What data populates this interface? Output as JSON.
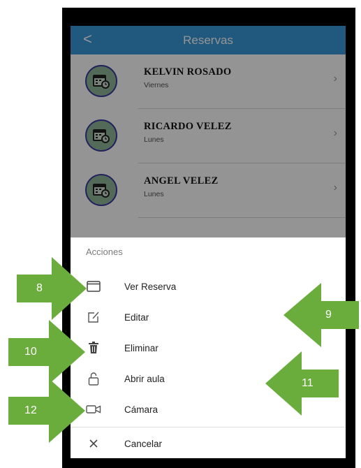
{
  "header": {
    "back_icon": "chevron-left-icon",
    "back_glyph": "<",
    "title": "Reservas"
  },
  "reservations": [
    {
      "name": "KELVIN ROSADO",
      "day": "Viernes"
    },
    {
      "name": "RICARDO VELEZ",
      "day": "Lunes"
    },
    {
      "name": "ANGEL VELEZ",
      "day": "Lunes"
    }
  ],
  "sheet": {
    "title": "Acciones",
    "actions": [
      {
        "label": "Ver Reserva",
        "icon": "window-icon"
      },
      {
        "label": "Editar",
        "icon": "edit-icon"
      },
      {
        "label": "Eliminar",
        "icon": "trash-icon"
      },
      {
        "label": "Abrir aula",
        "icon": "unlock-icon"
      },
      {
        "label": "Cámara",
        "icon": "video-camera-icon"
      },
      {
        "label": "Cancelar",
        "icon": "close-icon"
      }
    ]
  },
  "callouts": [
    {
      "number": "8"
    },
    {
      "number": "9"
    },
    {
      "number": "10"
    },
    {
      "number": "11"
    },
    {
      "number": "12"
    }
  ],
  "colors": {
    "header": "#3a9ad9",
    "avatar": "#8fb79a",
    "avatar_border": "#3a3aa0",
    "callout_arrow": "#6aad3d"
  }
}
